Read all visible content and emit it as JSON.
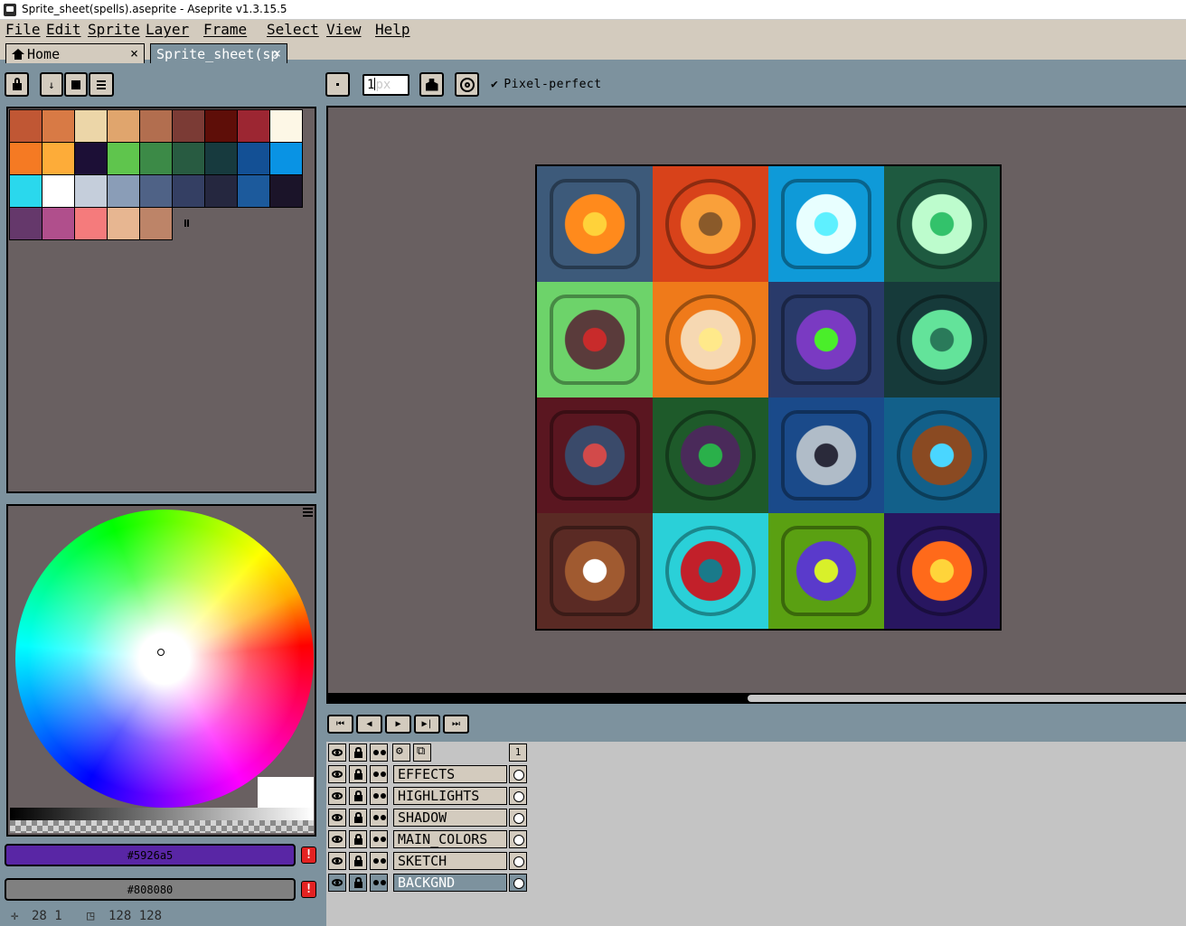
{
  "window": {
    "title": "Sprite_sheet(spells).aseprite - Aseprite v1.3.15.5"
  },
  "menu": [
    "File",
    "Edit",
    "Sprite",
    "Layer",
    "Frame",
    "Select",
    "View",
    "Help"
  ],
  "tabs": [
    {
      "label": "Home",
      "close": "×"
    },
    {
      "label": "Sprite_sheet(sp",
      "close": "×"
    }
  ],
  "toolbar": {
    "brush_size_value": "1",
    "brush_size_placeholder": "px",
    "pixel_perfect_check": "✔",
    "pixel_perfect_label": "Pixel-perfect"
  },
  "palette": {
    "colors": [
      "#c05734",
      "#d87a45",
      "#ecd6a8",
      "#e0a56d",
      "#b26e4f",
      "#7b3b35",
      "#5e0e08",
      "#9c2632",
      "#fdf7e6",
      "#f57a23",
      "#fdac39",
      "#1c0f36",
      "#5fc54d",
      "#3c8a47",
      "#285b41",
      "#173a3e",
      "#135095",
      "#0993e4",
      "#2ad8ed",
      "#ffffff",
      "#c5cedb",
      "#8a9db7",
      "#4f6286",
      "#343f63",
      "#25273f",
      "#1c5a9c",
      "#1b1429",
      "#65386b",
      "#b04f8c",
      "#f57b7c",
      "#e7b691",
      "#bd8468"
    ]
  },
  "colors": {
    "foreground": "#5926a5",
    "background": "#808080",
    "warning": "!"
  },
  "status": {
    "cursor_pos": "28 1",
    "sprite_size": "128 128"
  },
  "animation_controls": [
    "⏮",
    "◀",
    "▶",
    "▶|",
    "⏭"
  ],
  "layers": [
    {
      "name": "EFFECTS"
    },
    {
      "name": "HIGHLIGHTS"
    },
    {
      "name": "SHADOW"
    },
    {
      "name": "MAIN_COLORS"
    },
    {
      "name": "SKETCH"
    },
    {
      "name": "BACKGND"
    }
  ],
  "timeline": {
    "frame_number": "1"
  },
  "sprite_cells": [
    {
      "icon": "fireball-icon",
      "bg": "#3d5a7a",
      "fg": "#ff8a1c",
      "accent": "#ffd23a"
    },
    {
      "icon": "flaming-spear-icon",
      "bg": "#d8421a",
      "fg": "#f9a03a",
      "accent": "#8a5a2a"
    },
    {
      "icon": "lightning-arrow-icon",
      "bg": "#0f9ad8",
      "fg": "#e8ffff",
      "accent": "#5ef0ff"
    },
    {
      "icon": "healing-cross-icon",
      "bg": "#1e5a40",
      "fg": "#bdfccd",
      "accent": "#33c26b"
    },
    {
      "icon": "arrow-shield-icon",
      "bg": "#6dd36a",
      "fg": "#5a3b3b",
      "accent": "#c82b2b"
    },
    {
      "icon": "power-fist-icon",
      "bg": "#ef7a1a",
      "fg": "#f6d8b2",
      "accent": "#ffe98a"
    },
    {
      "icon": "poison-hand-icon",
      "bg": "#293a6a",
      "fg": "#7a3ac2",
      "accent": "#4aee2a"
    },
    {
      "icon": "wind-spirit-icon",
      "bg": "#163a3a",
      "fg": "#63e39a",
      "accent": "#2a7a5a"
    },
    {
      "icon": "crossed-axes-icon",
      "bg": "#5a1620",
      "fg": "#3a4a6a",
      "accent": "#d24a4a"
    },
    {
      "icon": "hooded-figure-icon",
      "bg": "#1e5a2a",
      "fg": "#4a2a5a",
      "accent": "#2ab04a"
    },
    {
      "icon": "armor-icon",
      "bg": "#1a4a8a",
      "fg": "#b0bcc8",
      "accent": "#2a2a3a"
    },
    {
      "icon": "winged-boot-icon",
      "bg": "#12608a",
      "fg": "#8a4a22",
      "accent": "#4ad6ff"
    },
    {
      "icon": "wooden-shield-icon",
      "bg": "#5a2a24",
      "fg": "#a05a30",
      "accent": "#ffffff"
    },
    {
      "icon": "heart-icon",
      "bg": "#2ad0d8",
      "fg": "#c2202a",
      "accent": "#1a7a8a"
    },
    {
      "icon": "vortex-orb-icon",
      "bg": "#5aa012",
      "fg": "#5a3acb",
      "accent": "#d8f02a"
    },
    {
      "icon": "fire-burst-icon",
      "bg": "#281660",
      "fg": "#ff6a1a",
      "accent": "#ffd43a"
    }
  ]
}
